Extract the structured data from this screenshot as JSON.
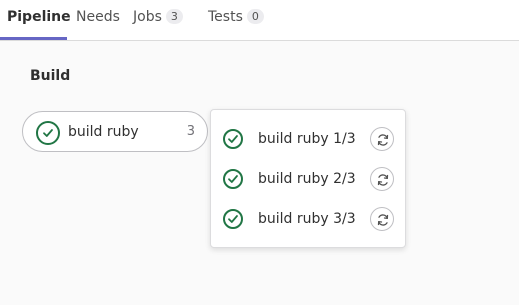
{
  "tabs": [
    {
      "label": "Pipeline",
      "active": true
    },
    {
      "label": "Needs"
    },
    {
      "label": "Jobs",
      "count": "3"
    },
    {
      "label": "Tests",
      "count": "0"
    }
  ],
  "stage": {
    "title": "Build",
    "group": {
      "name": "build ruby",
      "count": "3",
      "status_icon": "status-success-icon"
    },
    "jobs": [
      {
        "name": "build ruby 1/3",
        "status_icon": "status-success-icon",
        "action_icon": "retry-icon"
      },
      {
        "name": "build ruby 2/3",
        "status_icon": "status-success-icon",
        "action_icon": "retry-icon"
      },
      {
        "name": "build ruby 3/3",
        "status_icon": "status-success-icon",
        "action_icon": "retry-icon"
      }
    ]
  },
  "colors": {
    "success": "#217645",
    "active_tab_underline": "#6666c4",
    "badge_bg": "#ececef"
  }
}
